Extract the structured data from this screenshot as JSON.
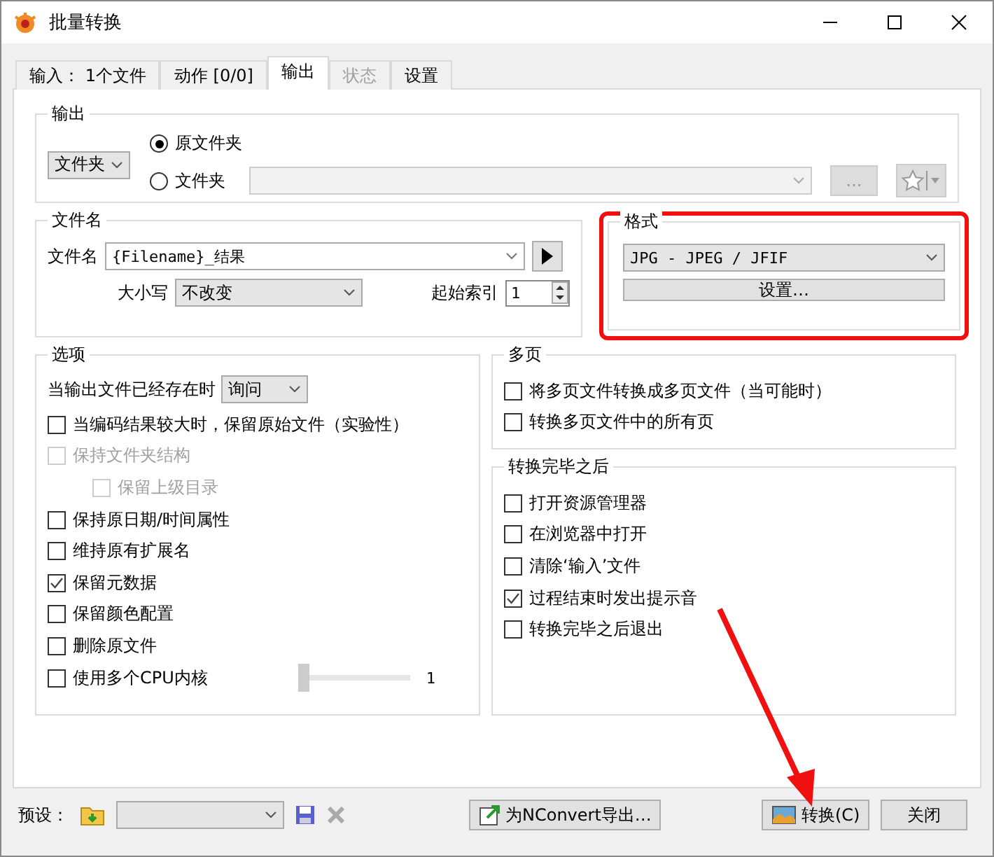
{
  "window": {
    "title": "批量转换"
  },
  "tabs": [
    {
      "label": "输入： 1个文件",
      "selected": false,
      "disabled": false
    },
    {
      "label": "动作 [0/0]",
      "selected": false,
      "disabled": false
    },
    {
      "label": "输出",
      "selected": true,
      "disabled": false
    },
    {
      "label": "状态",
      "selected": false,
      "disabled": true
    },
    {
      "label": "设置",
      "selected": false,
      "disabled": false
    }
  ],
  "output": {
    "title": "输出",
    "mode": "文件夹",
    "radios": [
      {
        "label": "原文件夹",
        "selected": true
      },
      {
        "label": "文件夹",
        "selected": false
      }
    ],
    "browse_button": "..."
  },
  "filename": {
    "title": "文件名",
    "label": "文件名",
    "value": "{Filename}_结果",
    "case_label": "大小写",
    "case_value": "不改变",
    "start_label": "起始索引",
    "start_value": "1"
  },
  "format": {
    "title": "格式",
    "value": "JPG - JPEG / JFIF",
    "settings_button": "设置…"
  },
  "options": {
    "title": "选项",
    "exists_label": "当输出文件已经存在时",
    "exists_value": "询问",
    "items": [
      {
        "kind": "checkbox",
        "label": "当编码结果较大时，保留原始文件（实验性）",
        "checked": false,
        "disabled": false
      },
      {
        "kind": "checkbox",
        "label": "保持文件夹结构",
        "checked": false,
        "disabled": true,
        "children": [
          {
            "label": "保留上级目录",
            "checked": false,
            "disabled": true
          }
        ]
      },
      {
        "kind": "checkbox",
        "label": "保持原日期/时间属性",
        "checked": false,
        "disabled": false
      },
      {
        "kind": "checkbox",
        "label": "维持原有扩展名",
        "checked": false,
        "disabled": false
      },
      {
        "kind": "checkbox",
        "label": "保留元数据",
        "checked": true,
        "disabled": false
      },
      {
        "kind": "checkbox",
        "label": "保留颜色配置",
        "checked": false,
        "disabled": false
      },
      {
        "kind": "checkbox",
        "label": "删除原文件",
        "checked": false,
        "disabled": false
      },
      {
        "kind": "slider",
        "label": "使用多个CPU内核",
        "checked": false,
        "disabled": false,
        "level": 0,
        "reading": "1"
      }
    ]
  },
  "multipage": {
    "title": "多页",
    "items": [
      {
        "label": "将多页文件转换成多页文件（当可能时）",
        "checked": false
      },
      {
        "label": "转换多页文件中的所有页",
        "checked": false
      }
    ]
  },
  "after": {
    "title": "转换完毕之后",
    "items": [
      {
        "label": "打开资源管理器",
        "checked": false
      },
      {
        "label": "在浏览器中打开",
        "checked": false
      },
      {
        "label": "清除‘输入’文件",
        "checked": false
      },
      {
        "label": "过程结束时发出提示音",
        "checked": true
      },
      {
        "label": "转换完毕之后退出",
        "checked": false
      }
    ]
  },
  "footer": {
    "preset_label": "预设：",
    "export_button": "为NConvert导出…",
    "convert_button": "转换(C)",
    "close_button": "关闭"
  }
}
